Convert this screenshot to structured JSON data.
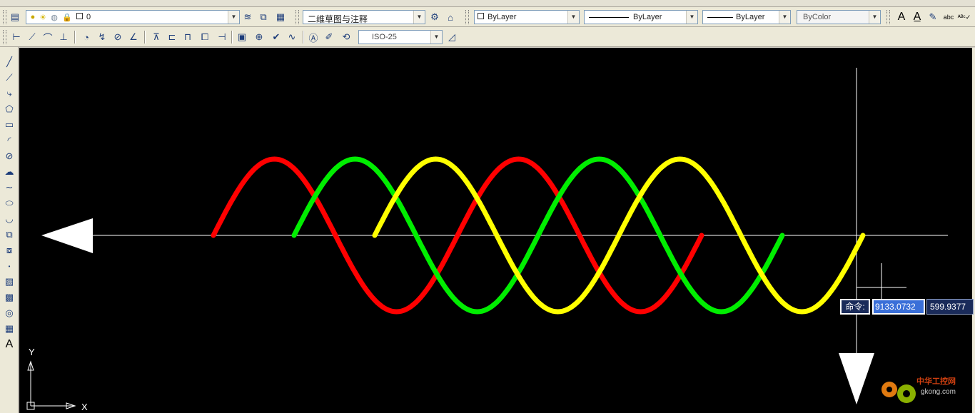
{
  "toolbar": {
    "layer_value": "0",
    "workspace_value": "二维草图与注释",
    "color_value": "ByLayer",
    "linetype_value": "ByLayer",
    "lineweight_value": "ByLayer",
    "plotstyle_value": "ByColor",
    "dimstyle_value": "ISO-25",
    "text_icon": "A",
    "abc_icon": "abc"
  },
  "left_toolbar": {
    "text_tool": "A"
  },
  "canvas": {
    "background": "#000000",
    "wave_colors": [
      "#ff0000",
      "#00ee00",
      "#ffff00"
    ],
    "ucs_x_label": "X",
    "ucs_y_label": "Y"
  },
  "command": {
    "label": "命令:",
    "x_value": "9133.0732",
    "y_value": "599.9377"
  },
  "watermark": {
    "brand_text": "中华工控网",
    "url_text": "gkong.com"
  }
}
